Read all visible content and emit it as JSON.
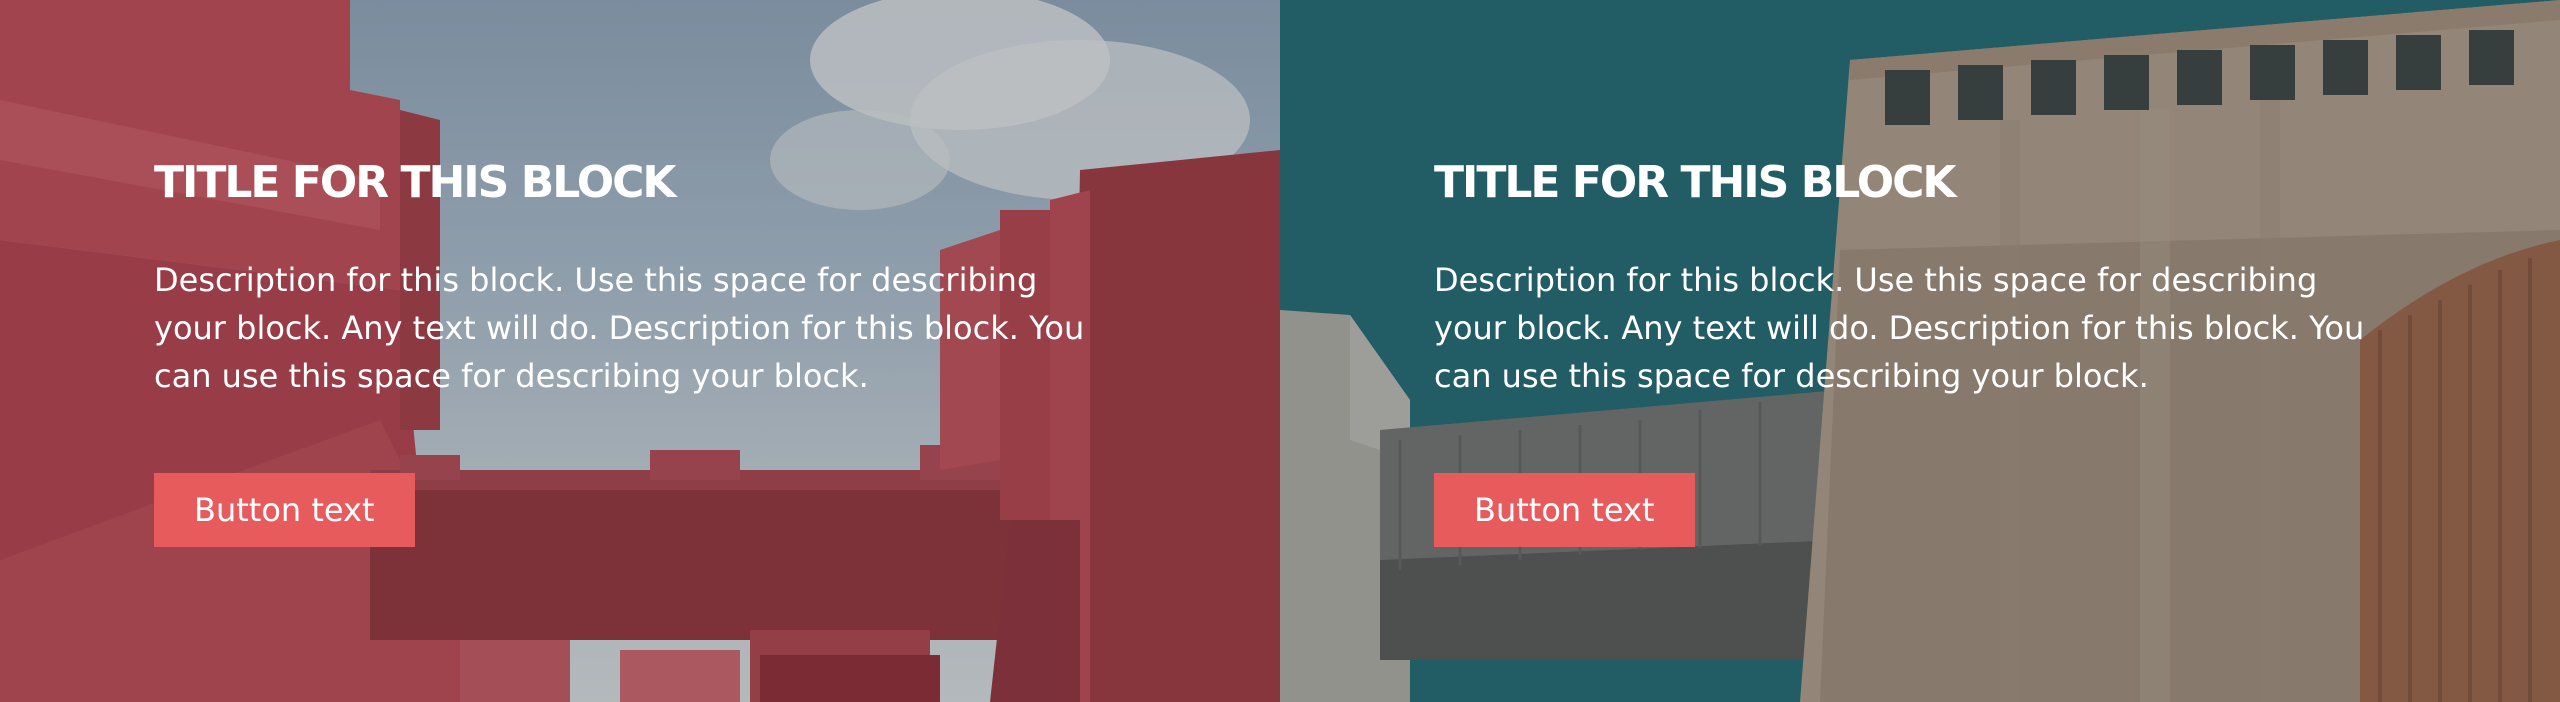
{
  "blocks": [
    {
      "title": "TITLE FOR THIS BLOCK",
      "description": "Description for this block. Use this space for describing your block. Any text will do. Description for this block. You can use this space for describing your block.",
      "button_label": "Button text",
      "background": "red-architecture-photo"
    },
    {
      "title": "TITLE FOR THIS BLOCK",
      "description": "Description for this block. Use this space for describing your block. Any text will do. Description for this block. You can use this space for describing your block.",
      "button_label": "Button text",
      "background": "industrial-building-teal-sky-photo"
    }
  ],
  "colors": {
    "button": "#e85b5d",
    "text": "#ffffff",
    "left_overlay": "#b33a45",
    "right_sky": "#1e6a73"
  }
}
